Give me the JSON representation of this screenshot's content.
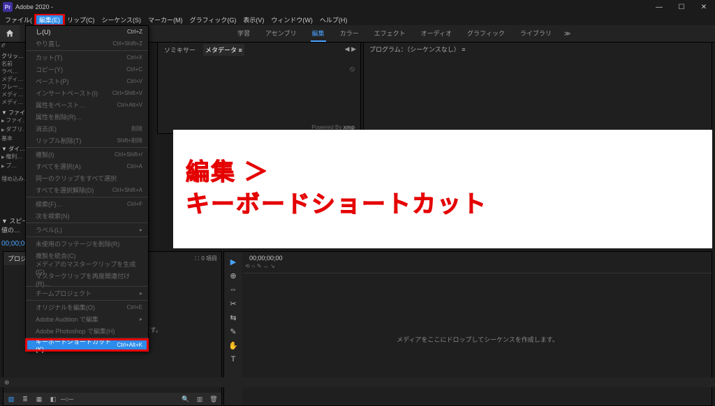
{
  "title": "Adobe              2020 -",
  "menubar": [
    "ファイル(",
    "編集(E)",
    "リップ(C)",
    "シーケンス(S)",
    "マーカー(M)",
    "グラフィック(G)",
    "表示(V)",
    "ウィンドウ(W)",
    "ヘルプ(H)"
  ],
  "workspaces": [
    "学習",
    "アセンブリ",
    "編集",
    "カラー",
    "エフェクト",
    "オーディオ",
    "グラフィック",
    "ライブラリ"
  ],
  "ws_more": "≫",
  "program_label": "プログラム：（シーケンスなし） ≡",
  "src_tabs": [
    "ソミキサー",
    "メタデータ ≡"
  ],
  "src_nav": "◀ ▶",
  "xmp_label": "Powered By xmp",
  "project_tab": "プロジ",
  "project_tools": "∷ 0 項目",
  "project_placeholder": "メディアを読み込んで開始します。",
  "timeline_tc": "00;00;00;00",
  "timeline_icons": "⟲ ∩ ✎ ↔ ↘",
  "timeline_placeholder": "メディアをここにドロップしてシーケンスを作成します。",
  "tools": [
    "▶",
    "⊕",
    "⇔",
    "✂",
    "⇆",
    "✎",
    "✋",
    "T"
  ],
  "speed_label": "▼ スピー…",
  "speed_line2": "   値の…",
  "tc_left": "00;00;00;00",
  "leftcol": {
    "search": "𝒪",
    "items1": [
      "クリッ…",
      "名前",
      "ラベ…",
      "メディ…",
      "フレー…",
      "メディ…",
      "メディ…"
    ],
    "grp1": "▼ ファイ…",
    "grp1_items": [
      "ファイ…",
      "ダブリ…",
      "基本"
    ],
    "grp2": "▼ ダイ…",
    "grp2_items": [
      "権利…",
      "プ…"
    ],
    "bottom": "埋め込み…"
  },
  "edit_menu": {
    "groups": [
      [
        {
          "label": "し(U)",
          "sc": "Ctrl+Z",
          "dis": false
        },
        {
          "label": "やり直し",
          "sc": "Ctrl+Shift+Z",
          "dis": true
        }
      ],
      [
        {
          "label": "カット(T)",
          "sc": "Ctrl+X",
          "dis": true
        },
        {
          "label": "コピー(Y)",
          "sc": "Ctrl+C",
          "dis": true
        },
        {
          "label": "ペースト(P)",
          "sc": "Ctrl+V",
          "dis": true
        },
        {
          "label": "インサートペースト(I)",
          "sc": "Ctrl+Shift+V",
          "dis": true
        },
        {
          "label": "属性をペースト…",
          "sc": "Ctrl+Alt+V",
          "dis": true
        },
        {
          "label": "属性を削除(R)…",
          "sc": "",
          "dis": true
        },
        {
          "label": "消去(E)",
          "sc": "削除",
          "dis": true
        },
        {
          "label": "リップル削除(T)",
          "sc": "Shift+削除",
          "dis": true
        }
      ],
      [
        {
          "label": "複製(I)",
          "sc": "Ctrl+Shift+/",
          "dis": true
        },
        {
          "label": "すべてを選択(A)",
          "sc": "Ctrl+A",
          "dis": true
        },
        {
          "label": "同一のクリップをすべて選択",
          "sc": "",
          "dis": true
        },
        {
          "label": "すべてを選択解除(D)",
          "sc": "Ctrl+Shift+A",
          "dis": true
        }
      ],
      [
        {
          "label": "検索(F)…",
          "sc": "Ctrl+F",
          "dis": true
        },
        {
          "label": "次を検索(N)",
          "sc": "",
          "dis": true
        }
      ],
      [
        {
          "label": "ラベル(L)",
          "sc": "",
          "dis": true,
          "sub": true
        }
      ],
      [
        {
          "label": "未使用のフッテージを削除(R)",
          "sc": "",
          "dis": true
        },
        {
          "label": "複製を統合(C)",
          "sc": "",
          "dis": true
        },
        {
          "label": "メディアのマスタークリップを生成(G)",
          "sc": "",
          "dis": true
        },
        {
          "label": "マスタークリップを再度関連付け(R)…",
          "sc": "",
          "dis": true
        }
      ],
      [
        {
          "label": "チームプロジェクト",
          "sc": "",
          "dis": true,
          "sub": true
        }
      ],
      [
        {
          "label": "オリジナルを編集(O)",
          "sc": "Ctrl+E",
          "dis": true
        },
        {
          "label": "Adobe Audition で編集",
          "sc": "",
          "dis": true,
          "sub": true
        },
        {
          "label": "Adobe Photoshop で編集(H)",
          "sc": "",
          "dis": true
        }
      ],
      [
        {
          "label": "キーボードショートカット(K)…",
          "sc": "Ctrl+Alt+K",
          "dis": false,
          "hl": true
        }
      ]
    ]
  },
  "annot": {
    "l1": "編集 ＞",
    "l2": "キーボードショートカット"
  },
  "status_icon": "⊕"
}
